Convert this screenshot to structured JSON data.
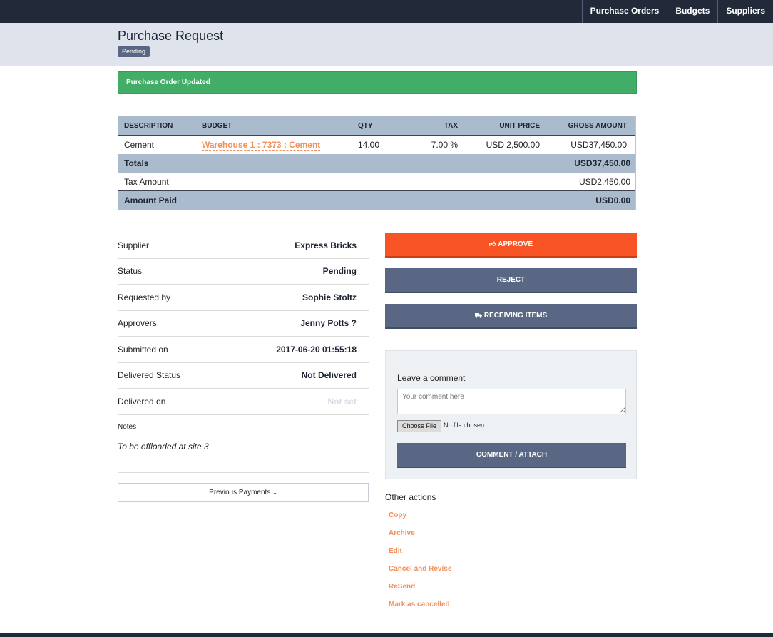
{
  "nav": {
    "items": [
      "Purchase Orders",
      "Budgets",
      "Suppliers"
    ]
  },
  "header": {
    "title": "Purchase Request",
    "status": "Pending"
  },
  "alert": {
    "message": "Purchase Order Updated"
  },
  "table": {
    "columns": [
      "DESCRIPTION",
      "BUDGET",
      "QTY",
      "TAX",
      "UNIT PRICE",
      "GROSS AMOUNT"
    ],
    "rows": [
      {
        "description": "Cement",
        "budget": "Warehouse 1 : 7373 : Cement",
        "qty": "14.00",
        "tax": "7.00 %",
        "unit_price": "USD 2,500.00",
        "gross": "USD37,450.00"
      }
    ],
    "totals_label": "Totals",
    "totals_value": "USD37,450.00",
    "tax_label": "Tax Amount",
    "tax_value": "USD2,450.00",
    "paid_label": "Amount Paid",
    "paid_value": "USD0.00"
  },
  "details": {
    "rows": [
      {
        "label": "Supplier",
        "value": "Express Bricks"
      },
      {
        "label": "Status",
        "value": "Pending"
      },
      {
        "label": "Requested by",
        "value": "Sophie Stoltz"
      },
      {
        "label": "Approvers",
        "value": "Jenny Potts ?"
      },
      {
        "label": "Submitted on",
        "value": "2017-06-20 01:55:18"
      },
      {
        "label": "Delivered Status",
        "value": "Not Delivered"
      },
      {
        "label": "Delivered on",
        "value": "Not set"
      }
    ],
    "notes_label": "Notes",
    "notes_text": "To be offloaded at site 3",
    "previous_payments": "Previous Payments"
  },
  "actions": {
    "approve": "APPROVE",
    "reject": "REJECT",
    "receiving": "RECEIVING ITEMS"
  },
  "comment": {
    "title": "Leave a comment",
    "placeholder": "Your comment here",
    "file_button": "Choose File",
    "file_status": "No file chosen",
    "submit": "COMMENT / ATTACH"
  },
  "other_actions": {
    "title": "Other actions",
    "items": [
      "Copy",
      "Archive",
      "Edit",
      "Cancel and Revise",
      "ReSend",
      "Mark as cancelled"
    ]
  },
  "colors": {
    "nav_bg": "#222a3a",
    "accent": "#f95426",
    "link": "#f28f5a",
    "success": "#42ad67",
    "slate_button": "#5a6784"
  },
  "icons": {
    "approve": "thumbs-up-icon",
    "receiving": "truck-icon",
    "previous_payments": "chevron-down-icon"
  }
}
